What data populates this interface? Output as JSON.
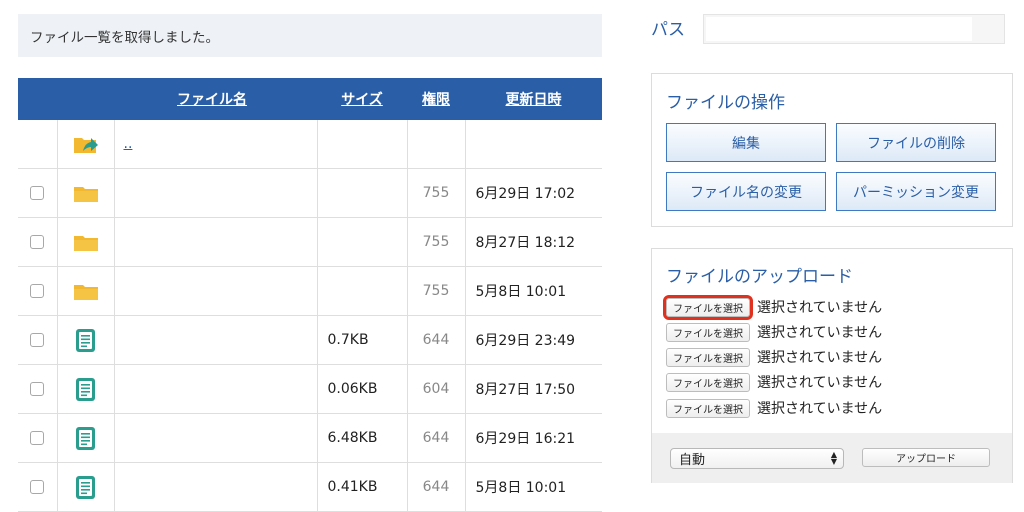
{
  "status_message": "ファイル一覧を取得しました。",
  "table": {
    "headers": {
      "name": "ファイル名",
      "size": "サイズ",
      "perm": "権限",
      "modified": "更新日時"
    },
    "parent_link": "..",
    "rows": [
      {
        "type": "folder",
        "name": "",
        "size": "",
        "perm": "755",
        "modified": "6月29日 17:02"
      },
      {
        "type": "folder",
        "name": "",
        "size": "",
        "perm": "755",
        "modified": "8月27日 18:12"
      },
      {
        "type": "folder",
        "name": "",
        "size": "",
        "perm": "755",
        "modified": "5月8日 10:01"
      },
      {
        "type": "file",
        "name": "",
        "size": "0.7KB",
        "perm": "644",
        "modified": "6月29日 23:49"
      },
      {
        "type": "file",
        "name": "",
        "size": "0.06KB",
        "perm": "604",
        "modified": "8月27日 17:50"
      },
      {
        "type": "file",
        "name": "",
        "size": "6.48KB",
        "perm": "644",
        "modified": "6月29日 16:21"
      },
      {
        "type": "file",
        "name": "",
        "size": "0.41KB",
        "perm": "644",
        "modified": "5月8日 10:01"
      }
    ]
  },
  "path": {
    "label": "パス",
    "value": ""
  },
  "operations": {
    "title": "ファイルの操作",
    "edit": "編集",
    "delete": "ファイルの削除",
    "rename": "ファイル名の変更",
    "permission": "パーミッション変更"
  },
  "upload": {
    "title": "ファイルのアップロード",
    "choose_label": "ファイルを選択",
    "no_file_label": "選択されていません",
    "mode_selected": "自動",
    "upload_button": "アップロード"
  },
  "colors": {
    "accent": "#2a5ea6",
    "header_bg": "#2a5ea6",
    "folder": "#f2b830",
    "file_icon": "#2a9d8f",
    "highlight": "#e0301e"
  }
}
